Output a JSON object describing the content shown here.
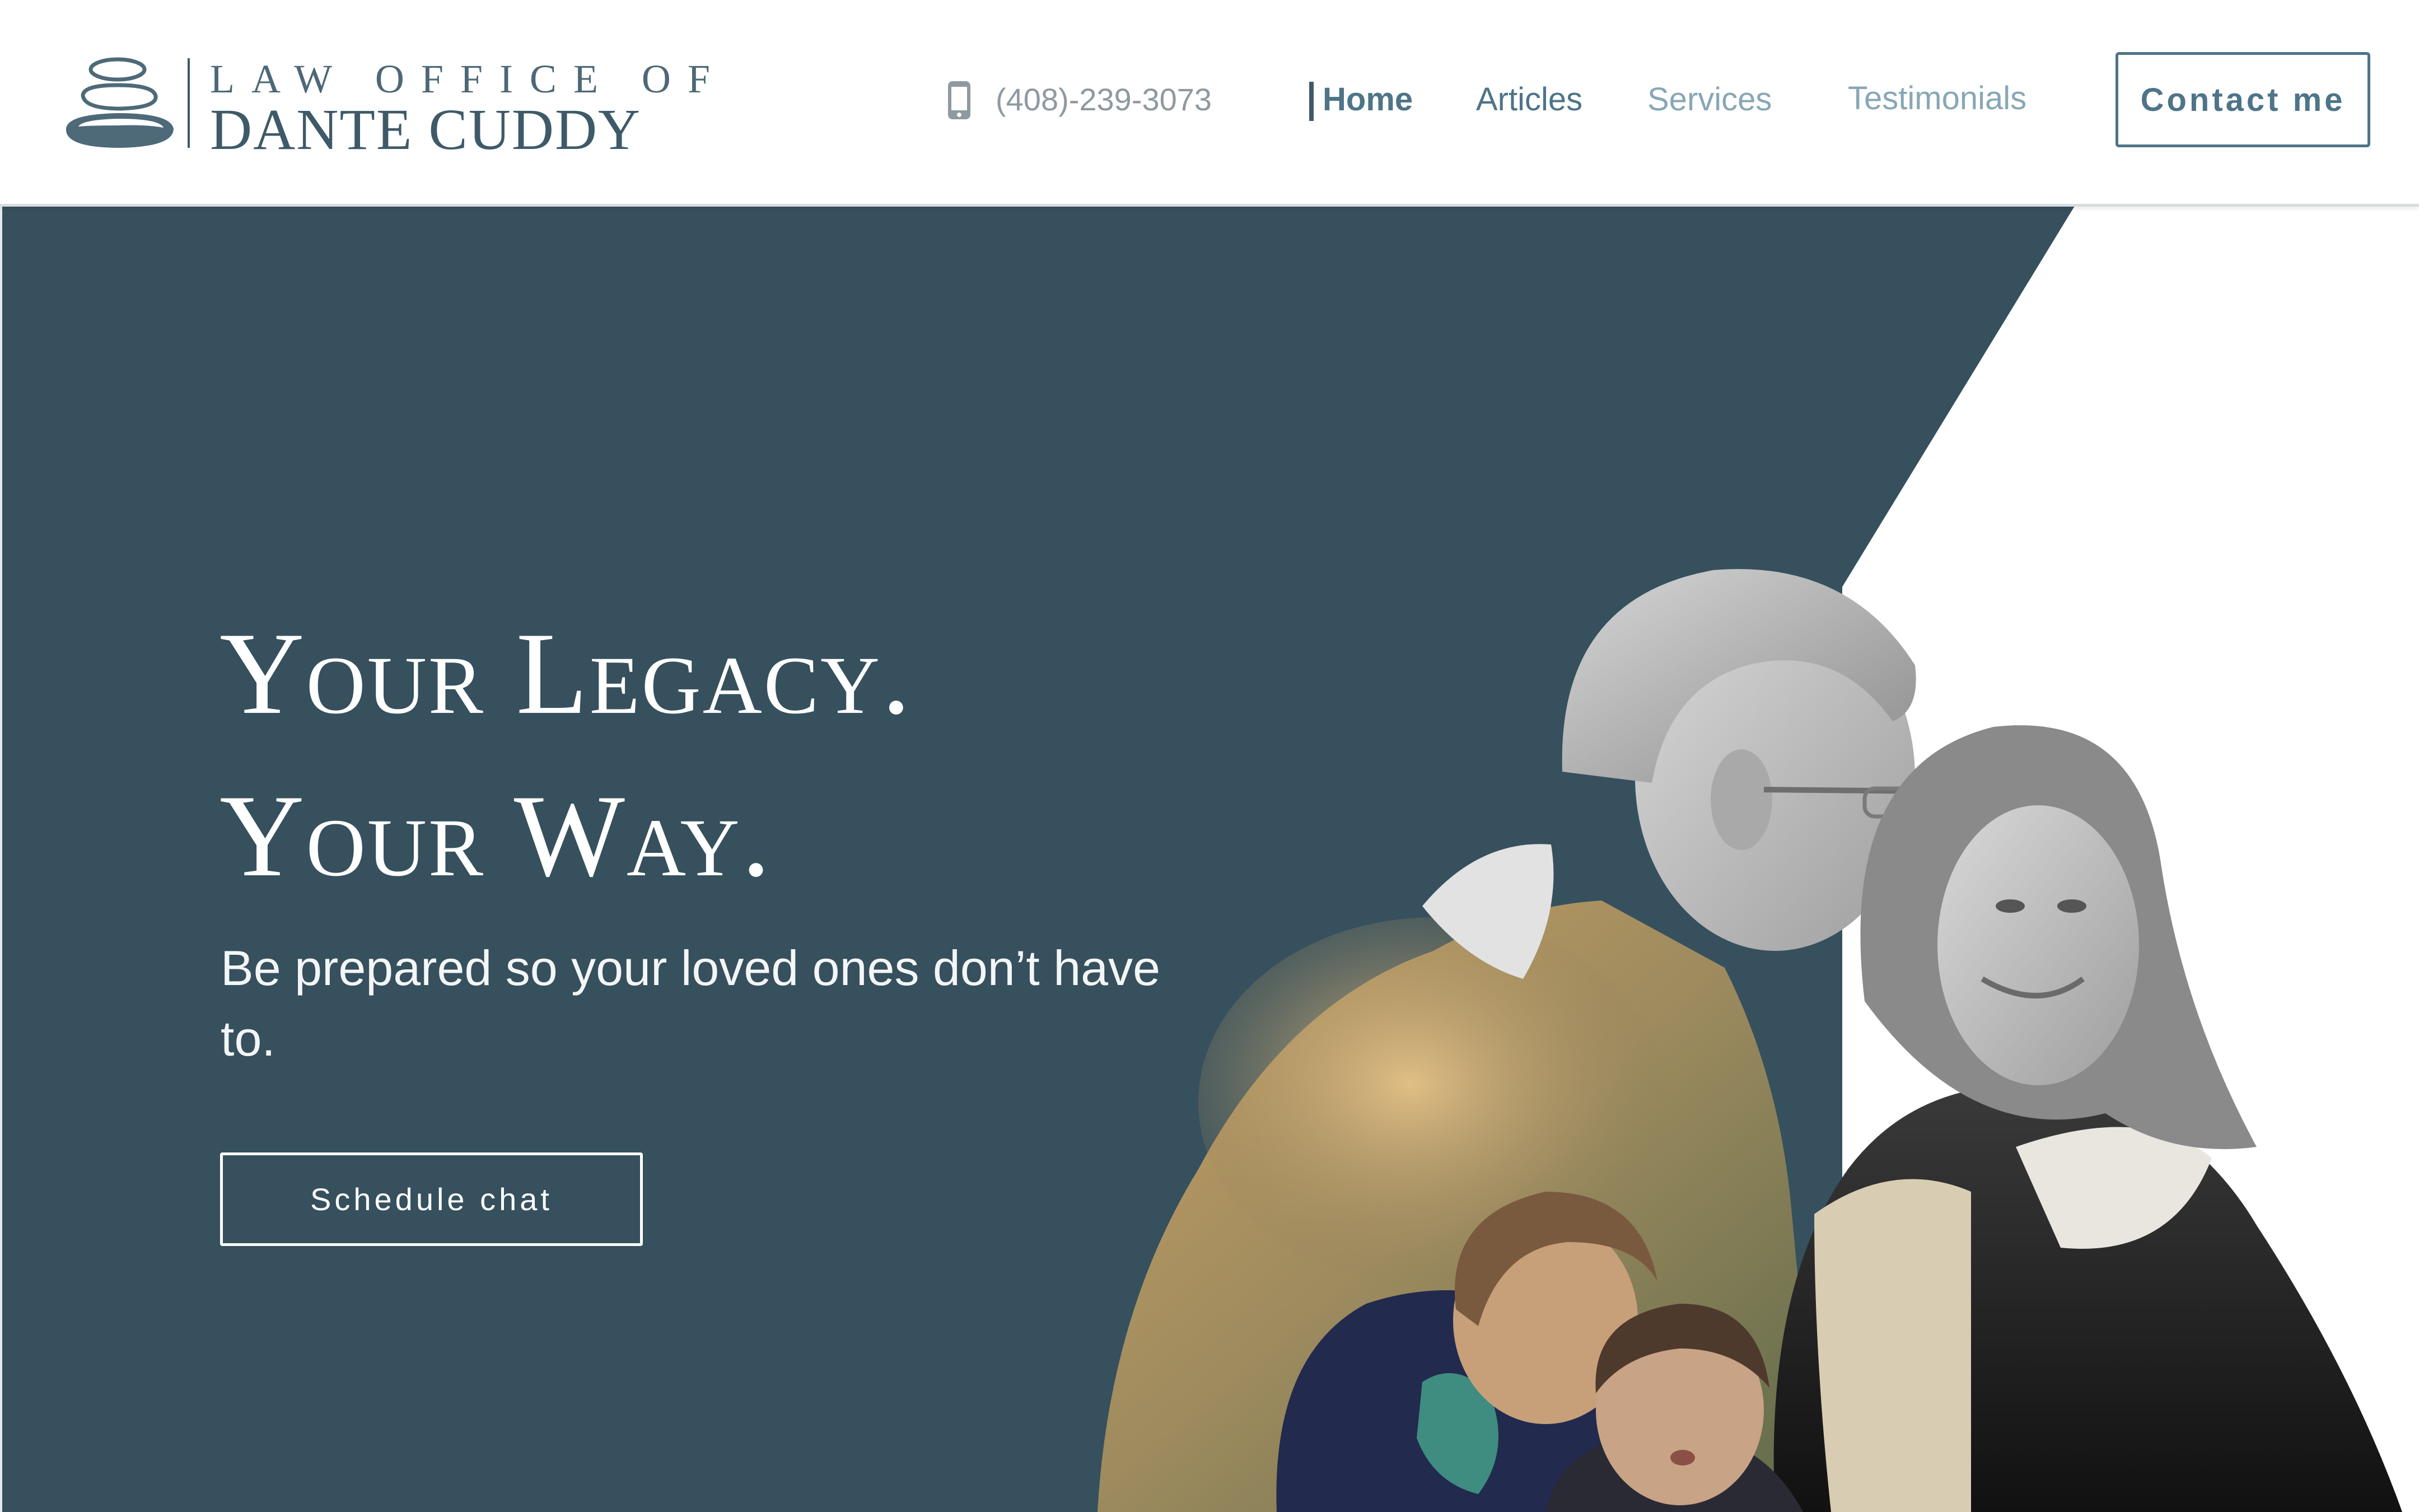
{
  "header": {
    "logo": {
      "line1": "LAW OFFICE OF",
      "line2": "DANTE CUDDY"
    },
    "phone": {
      "icon": "mobile-phone-icon",
      "number": "(408)-239-3073"
    },
    "nav": {
      "home": "Home",
      "articles": "Articles",
      "services": "Services",
      "testimonials": "Testimonials",
      "active": "Home"
    },
    "contact_button": "Contact me"
  },
  "hero": {
    "title_line1": "Your Legacy.",
    "title_line2": "Your Way.",
    "subtitle": "Be prepared so your loved ones don’t have to.",
    "cta_button": "Schedule chat"
  },
  "colors": {
    "primary": "#36505d",
    "accent": "#4e7488",
    "muted_nav": "#88a7b5",
    "white": "#ffffff"
  }
}
